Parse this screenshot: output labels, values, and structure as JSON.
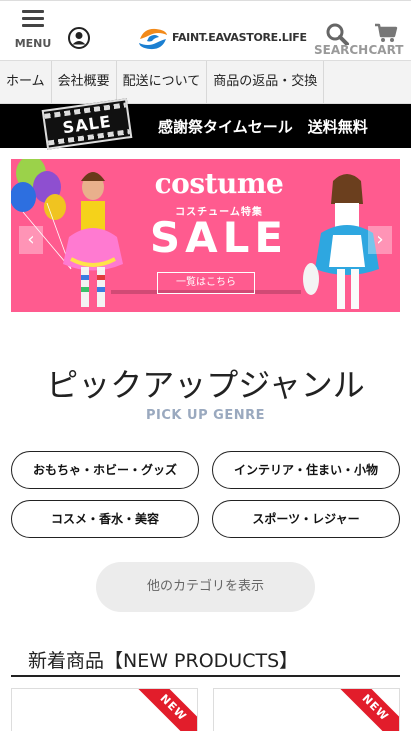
{
  "header": {
    "menu_label": "MENU",
    "logo_text": "FAINT.EAVASTORE.LIFE",
    "search_label": "SEARCH",
    "cart_label": "CART"
  },
  "nav": {
    "items": [
      "ホーム",
      "会社概要",
      "配送について",
      "商品の返品・交換"
    ]
  },
  "sale_bar": {
    "tag": "SALE",
    "text": "感謝祭タイムセール　送料無料"
  },
  "hero": {
    "title": "costume",
    "subtitle": "コスチューム特集",
    "headline": "SALE",
    "button": "一覧はこちら",
    "prev": "‹",
    "next": "›",
    "bg_color": "#ff5b8f"
  },
  "pickup": {
    "title": "ピックアップジャンル",
    "subtitle": "PICK UP GENRE",
    "genres": [
      "おもちゃ・ホビー・グッズ",
      "インテリア・住まい・小物",
      "コスメ・香水・美容",
      "スポーツ・レジャー"
    ],
    "more_button": "他のカテゴリを表示"
  },
  "new_products": {
    "title": "新着商品【NEW PRODUCTS】",
    "badge": "NEW"
  }
}
